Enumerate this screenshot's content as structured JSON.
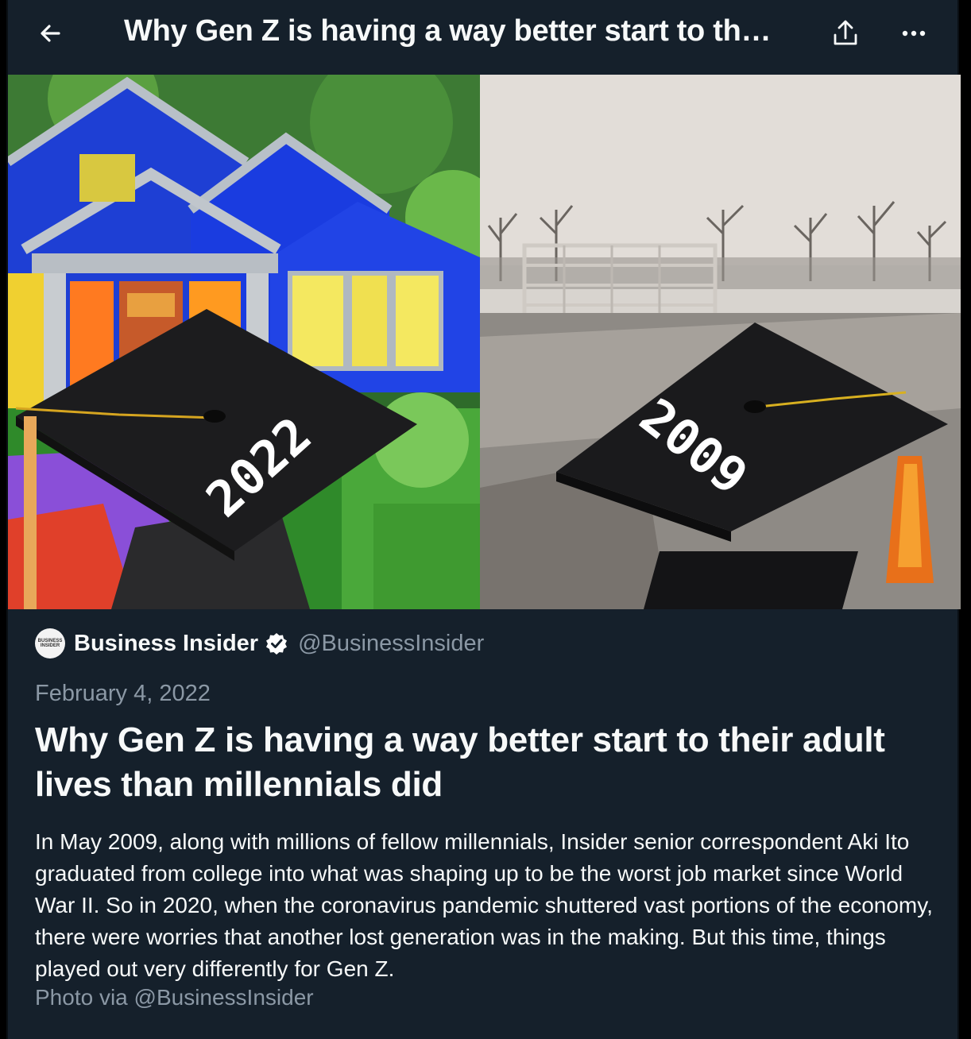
{
  "header": {
    "title": "Why Gen Z is having a way better start to th…",
    "back_icon": "arrow-left-icon",
    "share_icon": "share-icon",
    "more_icon": "more-horizontal-icon"
  },
  "hero": {
    "left_cap_text": "2022",
    "right_cap_text": "2009"
  },
  "publisher": {
    "logo_text": "BUSINESS INSIDER",
    "name": "Business Insider",
    "verified_icon": "verified-badge-icon",
    "handle": "@BusinessInsider"
  },
  "article": {
    "date": "February 4, 2022",
    "headline": "Why Gen Z is having a way better start to their adult lives than millennials did",
    "body": "In May 2009, along with millions of fellow millennials, Insider senior correspondent Aki Ito graduated from college into what was shaping up to be the worst job market since World War II. So in 2020, when the coronavirus pandemic shuttered vast portions of the economy, there were worries that another lost generation was in the making. But this time, things played out very differently for Gen Z.",
    "credit": "Photo via @BusinessInsider"
  },
  "colors": {
    "background": "#15202b",
    "primary_text": "#f7f9f9",
    "secondary_text": "#8b98a5",
    "verified": "#ffffff"
  }
}
